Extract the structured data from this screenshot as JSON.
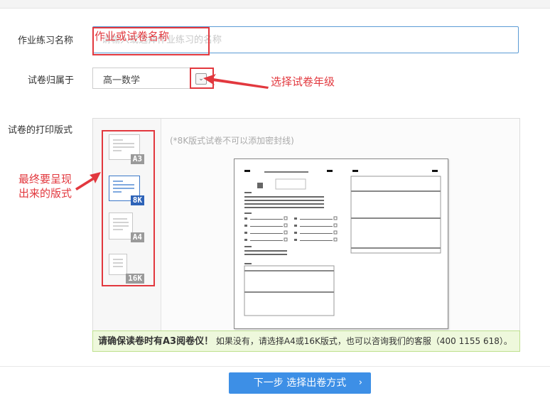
{
  "form": {
    "name_label": "作业练习名称",
    "name_placeholder": "请输入或选择作业练习的名称",
    "grade_label": "试卷归属于",
    "grade_value": "高一数学",
    "print_label": "试卷的打印版式"
  },
  "formats": [
    {
      "label": "A3",
      "active": false
    },
    {
      "label": "8K",
      "active": true
    },
    {
      "label": "A4",
      "active": false
    },
    {
      "label": "16K",
      "active": false
    }
  ],
  "panel": {
    "hint": "(*8K版式试卷不可以添加密封线)"
  },
  "annotations": {
    "name_note": "作业或试卷名称",
    "grade_note": "选择试卷年级",
    "format_note_line1": "最终要呈现",
    "format_note_line2": "出来的版式"
  },
  "notice": {
    "bold": "请确保读卷时有A3阅卷仪！",
    "rest": " 如果没有，请选择A4或16K版式，也可以咨询我们的客服（400 1155 618）。"
  },
  "actions": {
    "next_label": "下一步 选择出卷方式"
  },
  "colors": {
    "annotation_red": "#e2383e",
    "primary_blue": "#3d8fe6",
    "notice_green_bg": "#eef8dc"
  }
}
